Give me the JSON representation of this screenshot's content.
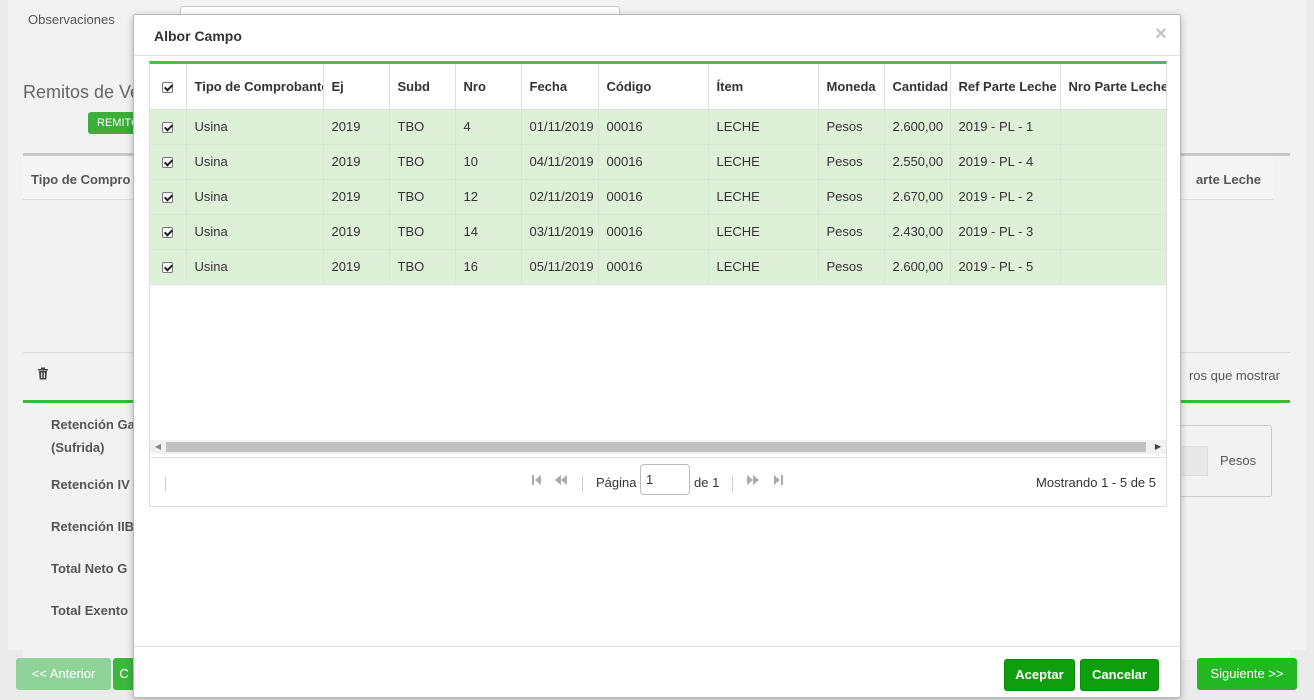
{
  "background": {
    "obs_label": "Observaciones",
    "section_title": "Remitos de Ve",
    "remito_button": "REMITO",
    "grid_col_first": "Tipo de Compro",
    "grid_col_last": "arte Leche",
    "no_records": "ros que mostrar",
    "totals": [
      "Retención Ga",
      "(Sufrida)",
      "Retención IV",
      "Retención IIB",
      "Total Neto G",
      "Total Exento"
    ],
    "pesos_label": "Pesos",
    "prev_button": "<< Anterior",
    "c_button": "C",
    "next_button": "Siguiente >>"
  },
  "modal": {
    "title": "Albor Campo",
    "close_glyph": "×",
    "columns": [
      "Tipo de Comprobante",
      "Ej",
      "Subd",
      "Nro",
      "Fecha",
      "Código",
      "Ítem",
      "Moneda",
      "Cantidad",
      "Ref Parte Leche",
      "Nro Parte Leche"
    ],
    "rows": [
      {
        "checked": true,
        "tipo": "Usina",
        "ej": "2019",
        "subd": "TBO",
        "nro": "4",
        "fecha": "01/11/2019",
        "codigo": "00016",
        "item": "LECHE",
        "moneda": "Pesos",
        "cantidad": "2.600,00",
        "ref": "2019 - PL - 1",
        "nro_parte": ""
      },
      {
        "checked": true,
        "tipo": "Usina",
        "ej": "2019",
        "subd": "TBO",
        "nro": "10",
        "fecha": "04/11/2019",
        "codigo": "00016",
        "item": "LECHE",
        "moneda": "Pesos",
        "cantidad": "2.550,00",
        "ref": "2019 - PL - 4",
        "nro_parte": ""
      },
      {
        "checked": true,
        "tipo": "Usina",
        "ej": "2019",
        "subd": "TBO",
        "nro": "12",
        "fecha": "02/11/2019",
        "codigo": "00016",
        "item": "LECHE",
        "moneda": "Pesos",
        "cantidad": "2.670,00",
        "ref": "2019 - PL - 2",
        "nro_parte": ""
      },
      {
        "checked": true,
        "tipo": "Usina",
        "ej": "2019",
        "subd": "TBO",
        "nro": "14",
        "fecha": "03/11/2019",
        "codigo": "00016",
        "item": "LECHE",
        "moneda": "Pesos",
        "cantidad": "2.430,00",
        "ref": "2019 - PL - 3",
        "nro_parte": ""
      },
      {
        "checked": true,
        "tipo": "Usina",
        "ej": "2019",
        "subd": "TBO",
        "nro": "16",
        "fecha": "05/11/2019",
        "codigo": "00016",
        "item": "LECHE",
        "moneda": "Pesos",
        "cantidad": "2.600,00",
        "ref": "2019 - PL - 5",
        "nro_parte": ""
      }
    ],
    "pager": {
      "page_label": "Página",
      "page_value": "1",
      "of_label": "de 1",
      "info": "Mostrando 1 - 5 de 5"
    },
    "buttons": {
      "accept": "Aceptar",
      "cancel": "Cancelar"
    }
  },
  "colors": {
    "accent_green": "#0e9e0e",
    "row_selected": "#dff0d8",
    "grid_top_border": "#3cc83c"
  }
}
